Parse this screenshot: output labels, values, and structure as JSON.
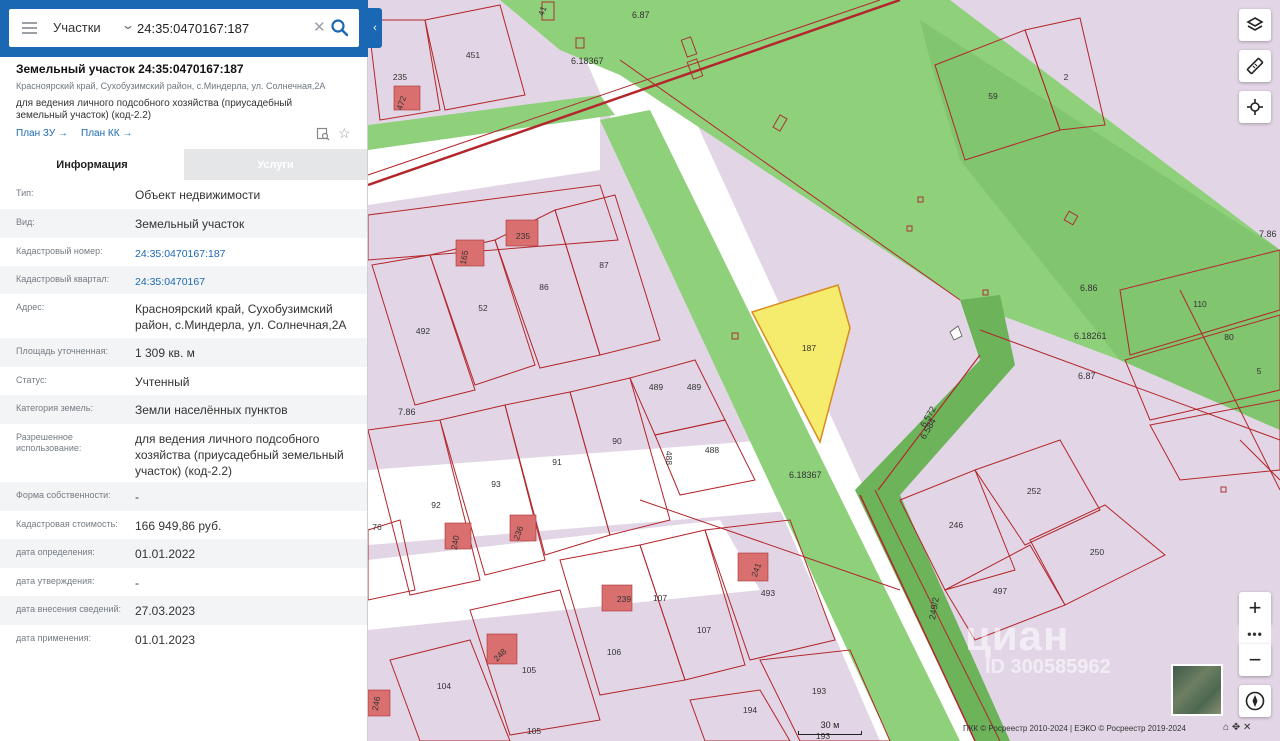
{
  "search": {
    "type_label": "Участки",
    "query": "24:35:0470167:187"
  },
  "object": {
    "title": "Земельный участок 24:35:0470167:187",
    "address_short": "Красноярский край, Сухобузимский район, с.Миндерла, ул. Солнечная,2А",
    "purpose": "для ведения личного подсобного хозяйства (приусадебный земельный участок) (код-2.2)",
    "plan_zu": "План ЗУ →",
    "plan_kk": "План КК →"
  },
  "tabs": {
    "info": "Информация",
    "services": "Услуги"
  },
  "info_rows": [
    {
      "label": "Тип:",
      "value": "Объект недвижимости",
      "link": false
    },
    {
      "label": "Вид:",
      "value": "Земельный участок",
      "link": false
    },
    {
      "label": "Кадастровый номер:",
      "value": "24:35:0470167:187",
      "link": true
    },
    {
      "label": "Кадастровый квартал:",
      "value": "24:35:0470167",
      "link": true
    },
    {
      "label": "Адрес:",
      "value": "Красноярский край, Сухобузимский район, с.Миндерла, ул. Солнечная,2А",
      "link": false
    },
    {
      "label": "Площадь уточненная:",
      "value": "1 309 кв. м",
      "link": false
    },
    {
      "label": "Статус:",
      "value": "Учтенный",
      "link": false
    },
    {
      "label": "Категория земель:",
      "value": "Земли населённых пунктов",
      "link": false
    },
    {
      "label": "Разрешенное использование:",
      "value": "для ведения личного подсобного хозяйства (приусадебный земельный участок) (код-2.2)",
      "link": false
    },
    {
      "label": "Форма собственности:",
      "value": "-",
      "link": false
    },
    {
      "label": "Кадастровая стоимость:",
      "value": "166 949,86 руб.",
      "link": false
    },
    {
      "label": "дата определения:",
      "value": "01.01.2022",
      "link": false
    },
    {
      "label": "дата утверждения:",
      "value": "-",
      "link": false
    },
    {
      "label": "дата внесения сведений:",
      "value": "27.03.2023",
      "link": false
    },
    {
      "label": "дата применения:",
      "value": "01.01.2023",
      "link": false
    }
  ],
  "map": {
    "lots": [
      "451",
      "235",
      "59",
      "2",
      "86",
      "87",
      "52",
      "492",
      "187",
      "110",
      "80",
      "5",
      "489",
      "489",
      "91",
      "90",
      "488",
      "488",
      "92",
      "93",
      "76",
      "252",
      "246",
      "250",
      "497",
      "493",
      "107",
      "107",
      "106",
      "105",
      "104",
      "105",
      "193",
      "194",
      "193",
      "41",
      "472",
      "165",
      "235",
      "240",
      "236",
      "241",
      "239",
      "248",
      "246"
    ],
    "road_labels": [
      "6.87",
      "6.18367",
      "6.86",
      "6.18261",
      "6.87",
      "7.86",
      "7.86",
      "6.572",
      "6.584",
      "6.18367",
      "249/2"
    ],
    "selected_lot": "187",
    "scale_label": "30 м",
    "attribution": "ПКК © Росреестр 2010-2024 | ЕЭКО © Росреестр 2019-2024",
    "watermark": "циан",
    "watermark_id": "ID 300585962",
    "colors": {
      "parcel_fill": "#e2d6e6",
      "green_zone": "#8fd07b",
      "selected_fill": "#f5ec6e",
      "boundary": "#b3262b",
      "accent": "#1a68b4"
    }
  }
}
